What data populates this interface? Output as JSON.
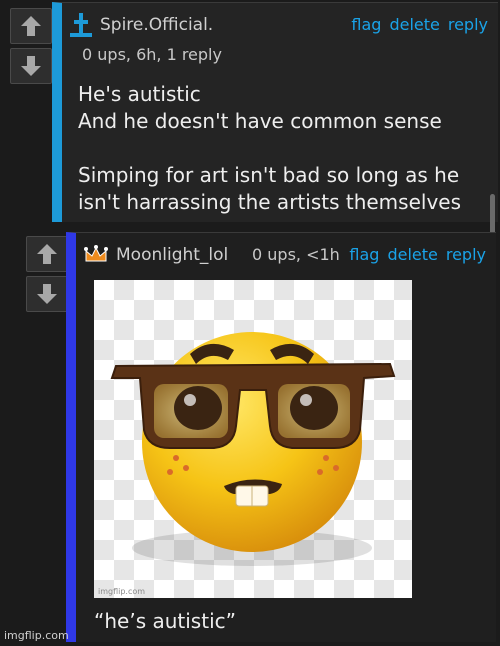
{
  "comments": [
    {
      "username": "Spire.Official.",
      "meta": "0 ups, 6h, 1 reply",
      "actions": [
        "flag",
        "delete",
        "reply"
      ],
      "body": [
        "He's autistic",
        "And he doesn't have common sense",
        "",
        "Simping for art isn't bad so long as he",
        "isn't harrassing the artists themselves"
      ],
      "accent_color": "#1d9ad8"
    },
    {
      "username": "Moonlight_lol",
      "meta": "0 ups, <1h",
      "actions": [
        "flag",
        "delete",
        "reply"
      ],
      "image_watermark": "imgflip.com",
      "caption": "“he’s autistic”",
      "accent_color": "#2f38e6"
    }
  ],
  "icons": {
    "upvote": "arrow-up-icon",
    "downvote": "arrow-down-icon",
    "user1_badge": "pillar-icon",
    "user2_badge": "crown-icon",
    "image": "nerd-face-emoji"
  },
  "watermark": "imgflip.com"
}
